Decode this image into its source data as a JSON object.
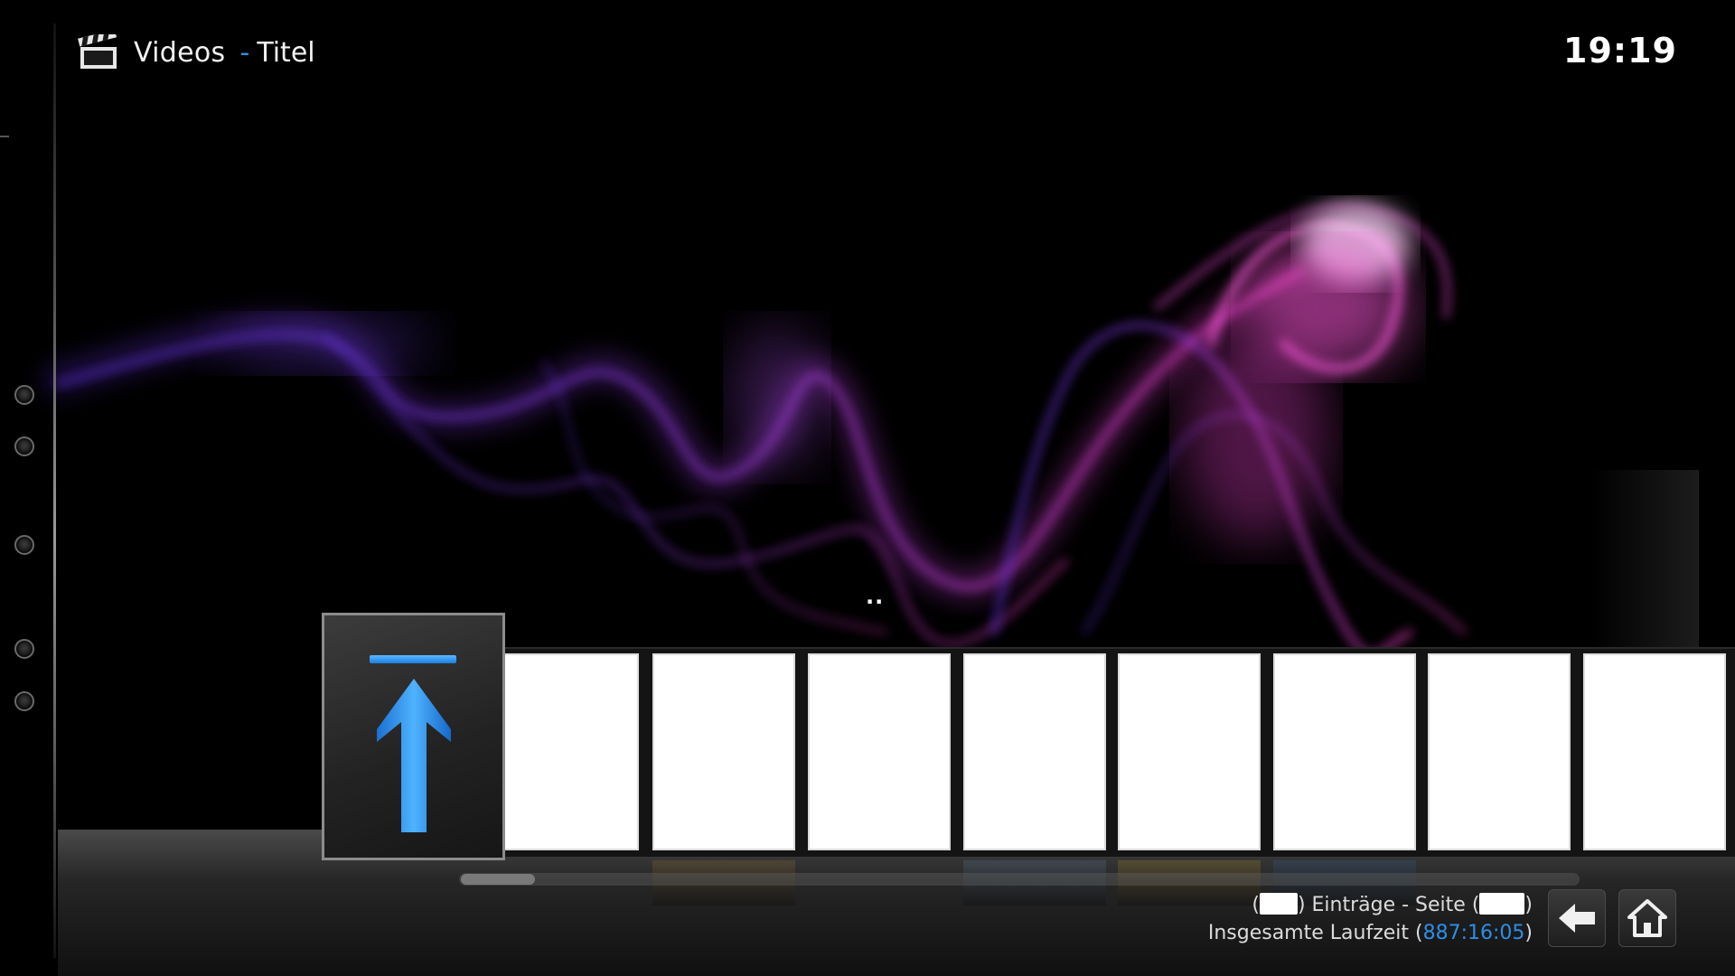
{
  "header": {
    "app_title": "Videos",
    "separator": "-",
    "view_title": "Titel",
    "clock": "19:19"
  },
  "content": {
    "parent_label": ".."
  },
  "footer": {
    "entries_open": "(",
    "entries_label": ") Einträge - Seite (",
    "entries_close": ")",
    "runtime_label": "Insgesamte Laufzeit (",
    "runtime_value": "887:16:05",
    "runtime_close": ")"
  },
  "colors": {
    "accent": "#2e8ee6",
    "background": "#000000"
  },
  "icons": {
    "section_icon": "clapperboard-icon",
    "back_icon": "back-arrow-icon",
    "home_icon": "home-icon",
    "parent_icon": "up-arrow-icon"
  }
}
